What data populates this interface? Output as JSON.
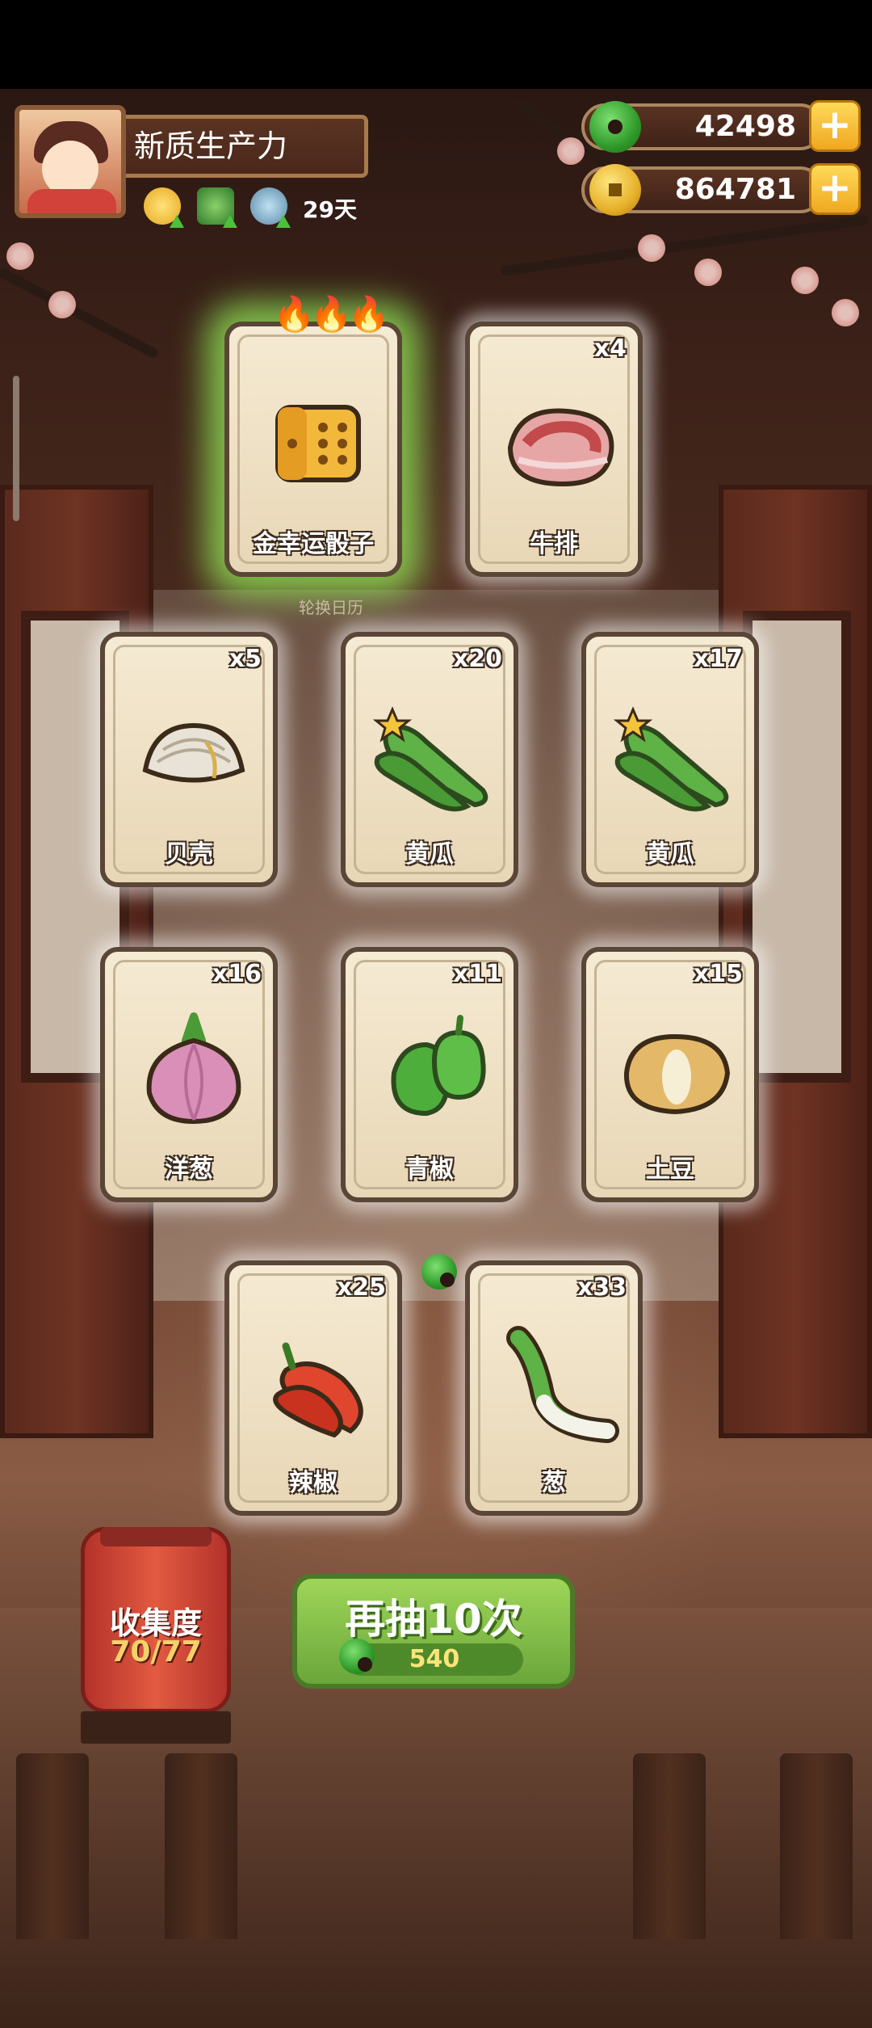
{
  "header": {
    "player_name": "新质生产力",
    "buff_days": "29天",
    "jade": "42498",
    "gold": "864781"
  },
  "cards": [
    {
      "name": "金幸运骰子",
      "count": "",
      "art": "golden-dice-icon",
      "highlight": true
    },
    {
      "name": "牛排",
      "count": "x4",
      "art": "steak-icon"
    },
    {
      "name": "贝壳",
      "count": "x5",
      "art": "clam-shell-icon"
    },
    {
      "name": "黄瓜",
      "count": "x20",
      "art": "cucumber-icon"
    },
    {
      "name": "黄瓜",
      "count": "x17",
      "art": "cucumber-icon"
    },
    {
      "name": "洋葱",
      "count": "x16",
      "art": "onion-icon"
    },
    {
      "name": "青椒",
      "count": "x11",
      "art": "green-pepper-icon"
    },
    {
      "name": "土豆",
      "count": "x15",
      "art": "potato-icon"
    },
    {
      "name": "辣椒",
      "count": "x25",
      "art": "chili-pepper-icon"
    },
    {
      "name": "葱",
      "count": "x33",
      "art": "scallion-icon"
    }
  ],
  "background_label": "轮换日历",
  "collection": {
    "title": "收集度",
    "value": "70/77"
  },
  "draw_again": {
    "label": "再抽10次",
    "cost": "540"
  },
  "colors": {
    "jade_green": "#3fae35",
    "gold": "#f0b52a",
    "button_green": "#8cc64d",
    "card_cream": "#f0e4ca"
  }
}
